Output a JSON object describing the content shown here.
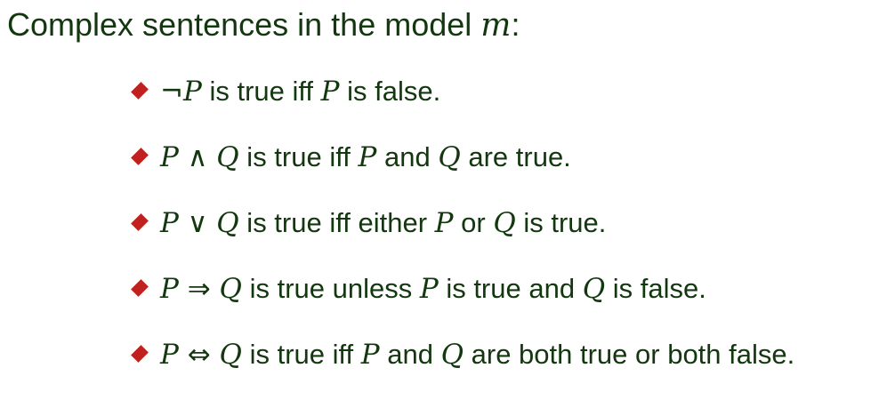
{
  "heading": {
    "text": "Complex sentences in the model ",
    "model_var": "m",
    "colon": ":"
  },
  "rules": [
    {
      "parts": [
        {
          "t": "op",
          "v": "¬"
        },
        {
          "t": "var",
          "v": "P"
        },
        {
          "t": "txt",
          "v": " is true iff "
        },
        {
          "t": "var",
          "v": "P"
        },
        {
          "t": "txt",
          "v": " is false."
        }
      ]
    },
    {
      "parts": [
        {
          "t": "var",
          "v": "P"
        },
        {
          "t": "op",
          "v": " ∧ "
        },
        {
          "t": "var",
          "v": "Q"
        },
        {
          "t": "txt",
          "v": " is true iff "
        },
        {
          "t": "var",
          "v": "P"
        },
        {
          "t": "txt",
          "v": " and "
        },
        {
          "t": "var",
          "v": "Q"
        },
        {
          "t": "txt",
          "v": " are true."
        }
      ]
    },
    {
      "parts": [
        {
          "t": "var",
          "v": "P"
        },
        {
          "t": "op",
          "v": " ∨ "
        },
        {
          "t": "var",
          "v": "Q"
        },
        {
          "t": "txt",
          "v": " is true iff either "
        },
        {
          "t": "var",
          "v": "P"
        },
        {
          "t": "txt",
          "v": " or "
        },
        {
          "t": "var",
          "v": "Q"
        },
        {
          "t": "txt",
          "v": " is true."
        }
      ]
    },
    {
      "parts": [
        {
          "t": "var",
          "v": "P"
        },
        {
          "t": "op",
          "v": " ⇒ "
        },
        {
          "t": "var",
          "v": "Q"
        },
        {
          "t": "txt",
          "v": " is true unless "
        },
        {
          "t": "var",
          "v": "P"
        },
        {
          "t": "txt",
          "v": " is true and "
        },
        {
          "t": "var",
          "v": "Q"
        },
        {
          "t": "txt",
          "v": " is false."
        }
      ]
    },
    {
      "parts": [
        {
          "t": "var",
          "v": "P"
        },
        {
          "t": "op",
          "v": " ⇔ "
        },
        {
          "t": "var",
          "v": "Q"
        },
        {
          "t": "txt",
          "v": " is true iff "
        },
        {
          "t": "var",
          "v": "P"
        },
        {
          "t": "txt",
          "v": " and "
        },
        {
          "t": "var",
          "v": "Q"
        },
        {
          "t": "txt",
          "v": " are both true or both false."
        }
      ]
    }
  ],
  "colors": {
    "text": "#13380f",
    "bullet": "#c0201e"
  }
}
